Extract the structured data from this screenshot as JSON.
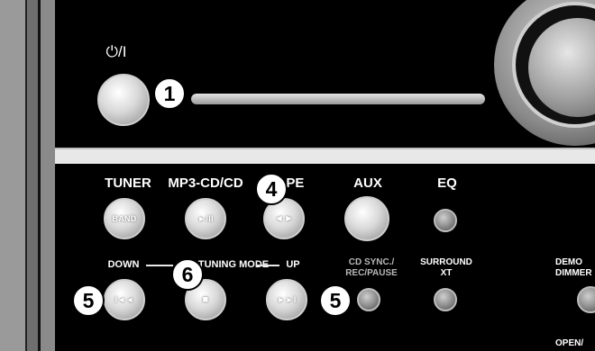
{
  "power": {
    "label": "⏻/I",
    "callout": "1"
  },
  "source_buttons": [
    {
      "label": "TUNER",
      "sub": "BAND"
    },
    {
      "label": "MP3-CD/CD",
      "sub": "►/II"
    },
    {
      "label": "TAPE",
      "sub": "◄►"
    },
    {
      "label": "AUX",
      "sub": ""
    },
    {
      "label": "EQ",
      "sub": ""
    }
  ],
  "tuning_row": {
    "down": "DOWN",
    "mode": "TUNING MODE",
    "up": "UP",
    "prev_sub": "I◄◄",
    "stop_sub": "■",
    "next_sub": "►►I",
    "cd_sync": "CD SYNC./\nREC/PAUSE",
    "surround": "SURROUND\nXT",
    "demo": "DEMO\nDIMMER",
    "open": "OPEN/"
  },
  "callouts": {
    "tape": "4",
    "down": "5",
    "mode": "6",
    "up": "5"
  }
}
